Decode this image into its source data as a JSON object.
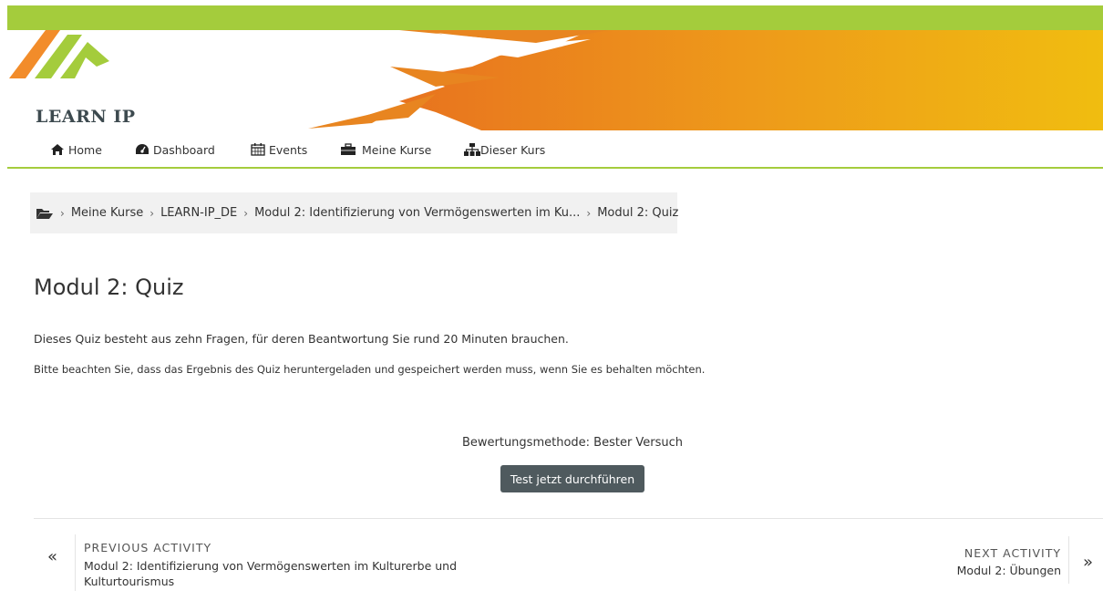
{
  "brand": {
    "logo_text": "LEARN IP",
    "colors": {
      "green": "#a4cc3c",
      "orange": "#f28c2a",
      "yellow": "#f0bd10",
      "button": "#4f5a5e"
    }
  },
  "nav": {
    "items": [
      {
        "label": "Home",
        "icon": "home-icon"
      },
      {
        "label": "Dashboard",
        "icon": "dashboard-icon"
      },
      {
        "label": "Events",
        "icon": "calendar-icon"
      },
      {
        "label": "Meine Kurse",
        "icon": "briefcase-icon"
      },
      {
        "label": "Dieser Kurs",
        "icon": "sitemap-icon"
      }
    ]
  },
  "breadcrumb": {
    "icon": "folder-icon",
    "items": [
      "Meine Kurse",
      "LEARN-IP_DE",
      "Modul 2: Identifizierung von Vermögenswerten im Ku...",
      "Modul 2: Quiz"
    ]
  },
  "main": {
    "title": "Modul 2: Quiz",
    "intro_1": "Dieses Quiz besteht aus zehn Fragen, für deren Beantwortung Sie rund 20 Minuten brauchen.",
    "intro_2": "Bitte beachten Sie, dass das Ergebnis des Quiz heruntergeladen und gespeichert werden muss, wenn Sie es behalten möchten.",
    "grading_method": "Bewertungsmethode: Bester Versuch",
    "attempt_button": "Test jetzt durchführen"
  },
  "activity_nav": {
    "prev_kicker": "PREVIOUS ACTIVITY",
    "prev_title": "Modul 2: Identifizierung von Vermögenswerten im Kulturerbe und Kulturtourismus",
    "prev_arrow": "«",
    "next_kicker": "NEXT ACTIVITY",
    "next_title": "Modul 2: Übungen",
    "next_arrow": "»"
  }
}
